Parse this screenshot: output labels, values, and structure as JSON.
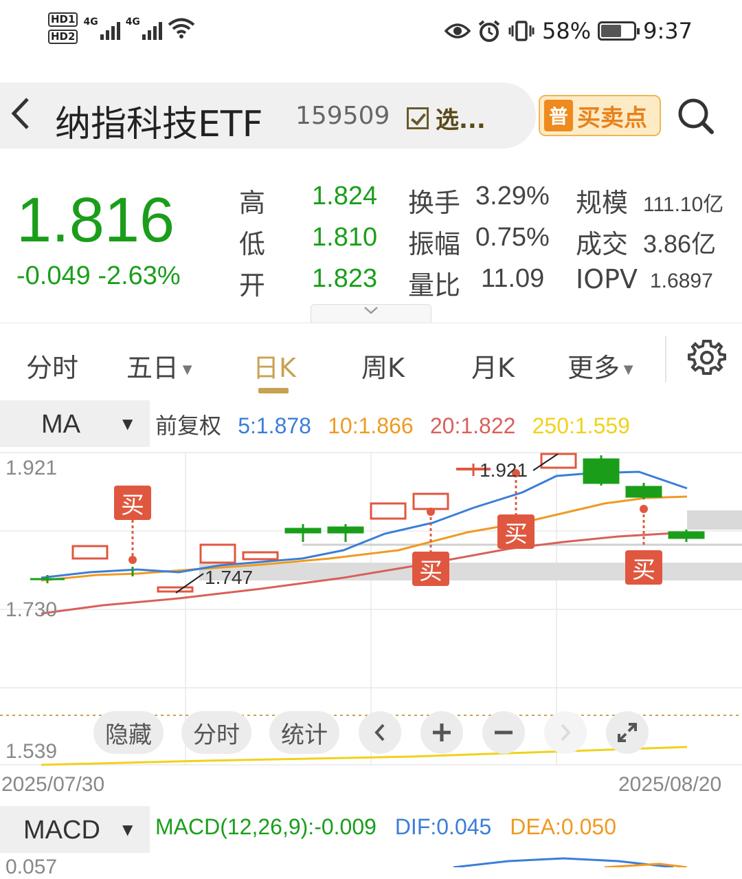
{
  "status_bar": {
    "hd1": "HD1",
    "hd2": "HD2",
    "net1": "4G",
    "net2": "4G",
    "battery": "58%",
    "time": "9:37",
    "icons": [
      "eye-icon",
      "alarm-icon",
      "vibrate-icon",
      "wifi-icon",
      "battery-icon"
    ]
  },
  "header": {
    "name": "纳指科技ETF",
    "code": "159509",
    "watch_label": "选...",
    "bs_badge": "普",
    "bs_label": "买卖点"
  },
  "quote": {
    "price": "1.816",
    "change": "-0.049",
    "change_pct": "-2.63%",
    "rows": [
      {
        "label": "高",
        "value": "1.824",
        "label2": "换手",
        "value2": "3.29%",
        "label3": "规模",
        "value3": "111.10亿"
      },
      {
        "label": "低",
        "value": "1.810",
        "label2": "振幅",
        "value2": "0.75%",
        "label3": "成交",
        "value3": "3.86亿"
      },
      {
        "label": "开",
        "value": "1.823",
        "label2": "量比",
        "value2": "11.09",
        "label3": "IOPV",
        "value3": "1.6897"
      }
    ]
  },
  "tabs": [
    {
      "label": "分时"
    },
    {
      "label": "五日"
    },
    {
      "label": "日K"
    },
    {
      "label": "周K"
    },
    {
      "label": "月K"
    },
    {
      "label": "更多"
    }
  ],
  "ma": {
    "selector": "MA",
    "adj": "前复权",
    "ma5": "5:1.878",
    "ma10": "10:1.866",
    "ma20": "20:1.822",
    "ma250": "250:1.559"
  },
  "chart": {
    "y_top": "1.921",
    "y_mid": "1.730",
    "y_low": "1.539",
    "date_start": "2025/07/30",
    "date_end": "2025/08/20",
    "min_label": "1.747",
    "max_label": "1.921",
    "buy_label": "买",
    "colors": {
      "up": "#e0573f",
      "down": "#1a9e1a",
      "ma5": "#3a7ed8",
      "ma10": "#ef9a22",
      "ma20": "#d8605a",
      "ma250": "#f0d21a"
    }
  },
  "controls": {
    "hide": "隐藏",
    "intraday": "分时",
    "stats": "统计"
  },
  "macd": {
    "selector": "MACD",
    "macd": "MACD(12,26,9):-0.009",
    "dif": "DIF:0.045",
    "dea": "DEA:0.050",
    "tick": "0.057"
  }
}
